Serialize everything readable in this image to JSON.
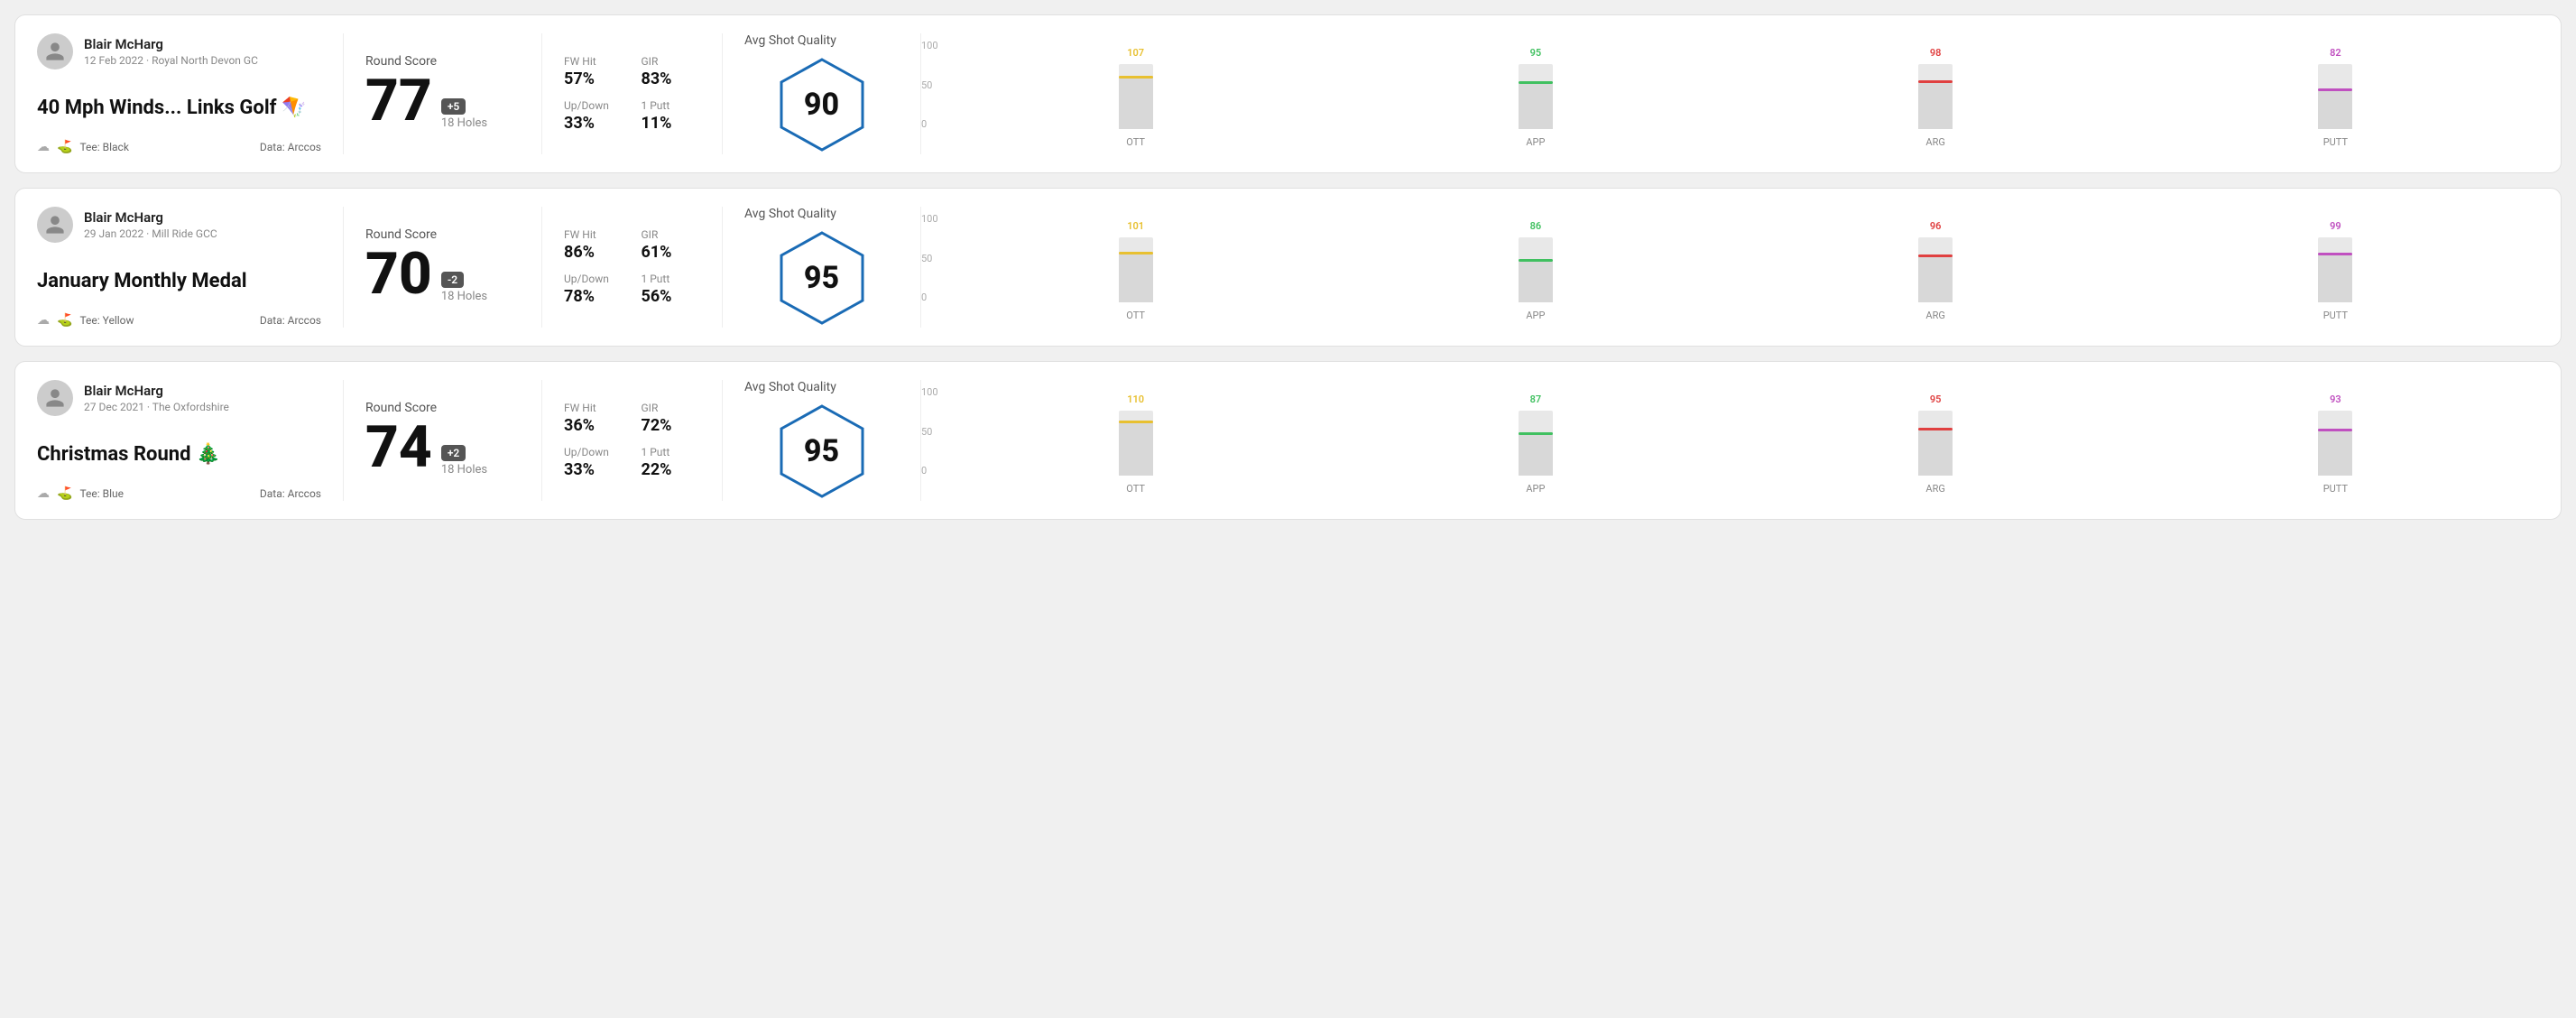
{
  "rounds": [
    {
      "id": "round-1",
      "user": {
        "name": "Blair McHarg",
        "date": "12 Feb 2022 · Royal North Devon GC"
      },
      "title": "40 Mph Winds... Links Golf 🪁",
      "tee": "Black",
      "data_source": "Data: Arccos",
      "round_score_label": "Round Score",
      "score": "77",
      "badge": "+5",
      "badge_type": "plus",
      "holes": "18 Holes",
      "fw_hit_label": "FW Hit",
      "fw_hit_value": "57%",
      "gir_label": "GIR",
      "gir_value": "83%",
      "up_down_label": "Up/Down",
      "up_down_value": "33%",
      "one_putt_label": "1 Putt",
      "one_putt_value": "11%",
      "avg_shot_quality_label": "Avg Shot Quality",
      "quality_score": "90",
      "chart": {
        "bars": [
          {
            "label": "OTT",
            "value": 107,
            "color": "#e8c030",
            "max": 130
          },
          {
            "label": "APP",
            "value": 95,
            "color": "#40c060",
            "max": 130
          },
          {
            "label": "ARG",
            "value": 98,
            "color": "#e04040",
            "max": 130
          },
          {
            "label": "PUTT",
            "value": 82,
            "color": "#c050c0",
            "max": 130
          }
        ],
        "y_labels": [
          "100",
          "50",
          "0"
        ]
      }
    },
    {
      "id": "round-2",
      "user": {
        "name": "Blair McHarg",
        "date": "29 Jan 2022 · Mill Ride GCC"
      },
      "title": "January Monthly Medal",
      "tee": "Yellow",
      "data_source": "Data: Arccos",
      "round_score_label": "Round Score",
      "score": "70",
      "badge": "-2",
      "badge_type": "minus",
      "holes": "18 Holes",
      "fw_hit_label": "FW Hit",
      "fw_hit_value": "86%",
      "gir_label": "GIR",
      "gir_value": "61%",
      "up_down_label": "Up/Down",
      "up_down_value": "78%",
      "one_putt_label": "1 Putt",
      "one_putt_value": "56%",
      "avg_shot_quality_label": "Avg Shot Quality",
      "quality_score": "95",
      "chart": {
        "bars": [
          {
            "label": "OTT",
            "value": 101,
            "color": "#e8c030",
            "max": 130
          },
          {
            "label": "APP",
            "value": 86,
            "color": "#40c060",
            "max": 130
          },
          {
            "label": "ARG",
            "value": 96,
            "color": "#e04040",
            "max": 130
          },
          {
            "label": "PUTT",
            "value": 99,
            "color": "#c050c0",
            "max": 130
          }
        ],
        "y_labels": [
          "100",
          "50",
          "0"
        ]
      }
    },
    {
      "id": "round-3",
      "user": {
        "name": "Blair McHarg",
        "date": "27 Dec 2021 · The Oxfordshire"
      },
      "title": "Christmas Round 🎄",
      "tee": "Blue",
      "data_source": "Data: Arccos",
      "round_score_label": "Round Score",
      "score": "74",
      "badge": "+2",
      "badge_type": "plus",
      "holes": "18 Holes",
      "fw_hit_label": "FW Hit",
      "fw_hit_value": "36%",
      "gir_label": "GIR",
      "gir_value": "72%",
      "up_down_label": "Up/Down",
      "up_down_value": "33%",
      "one_putt_label": "1 Putt",
      "one_putt_value": "22%",
      "avg_shot_quality_label": "Avg Shot Quality",
      "quality_score": "95",
      "chart": {
        "bars": [
          {
            "label": "OTT",
            "value": 110,
            "color": "#e8c030",
            "max": 130
          },
          {
            "label": "APP",
            "value": 87,
            "color": "#40c060",
            "max": 130
          },
          {
            "label": "ARG",
            "value": 95,
            "color": "#e04040",
            "max": 130
          },
          {
            "label": "PUTT",
            "value": 93,
            "color": "#c050c0",
            "max": 130
          }
        ],
        "y_labels": [
          "100",
          "50",
          "0"
        ]
      }
    }
  ]
}
